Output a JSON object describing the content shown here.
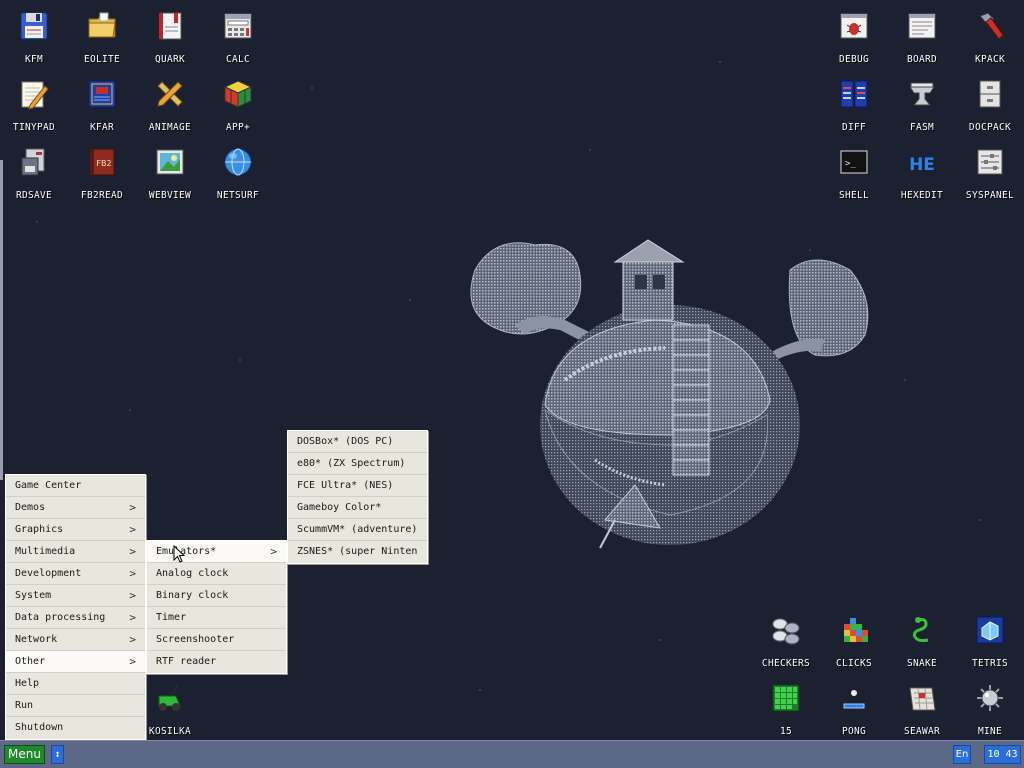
{
  "desktop_icons": {
    "kfm": {
      "label": "KFM",
      "icon": "floppy-icon"
    },
    "eolite": {
      "label": "EOLITE",
      "icon": "folder-icon"
    },
    "quark": {
      "label": "QUARK",
      "icon": "notebook-icon"
    },
    "calc": {
      "label": "CALC",
      "icon": "calculator-icon"
    },
    "tinypad": {
      "label": "TINYPAD",
      "icon": "pencil-paper-icon"
    },
    "kfar": {
      "label": "KFAR",
      "icon": "archive-icon"
    },
    "animage": {
      "label": "ANIMAGE",
      "icon": "ruler-pencil-icon"
    },
    "app_plus": {
      "label": "APP+",
      "icon": "rubik-cube-icon"
    },
    "rdsave": {
      "label": "RDSAVE",
      "icon": "save-disk-icon"
    },
    "fb2read": {
      "label": "FB2READ",
      "icon": "book-icon",
      "badge": "FB2"
    },
    "webview": {
      "label": "WEBVIEW",
      "icon": "web-image-icon"
    },
    "netsurf": {
      "label": "NETSURF",
      "icon": "globe-icon"
    },
    "debug": {
      "label": "DEBUG",
      "icon": "bug-window-icon"
    },
    "board": {
      "label": "BOARD",
      "icon": "board-window-icon"
    },
    "kpack": {
      "label": "KPACK",
      "icon": "hammer-icon"
    },
    "diff": {
      "label": "DIFF",
      "icon": "diff-icon"
    },
    "fasm": {
      "label": "FASM",
      "icon": "anvil-icon"
    },
    "docpack": {
      "label": "DOCPACK",
      "icon": "cabinet-icon"
    },
    "shell": {
      "label": "SHELL",
      "icon": "terminal-icon",
      "prompt": ">_"
    },
    "hexedit": {
      "label": "HEXEDIT",
      "icon": "hex-icon",
      "glyph": "HE"
    },
    "syspanel": {
      "label": "SYSPANEL",
      "icon": "sliders-icon"
    },
    "checkers": {
      "label": "CHECKERS",
      "icon": "checkers-icon"
    },
    "clicks": {
      "label": "CLICKS",
      "icon": "blocks-icon"
    },
    "snake": {
      "label": "SNAKE",
      "icon": "snake-icon"
    },
    "tetris": {
      "label": "TETRIS",
      "icon": "tetris-icon"
    },
    "game15": {
      "label": "15",
      "icon": "grid15-icon"
    },
    "pong": {
      "label": "PONG",
      "icon": "pong-icon"
    },
    "seawar": {
      "label": "SEAWAR",
      "icon": "seawar-icon"
    },
    "mine": {
      "label": "MINE",
      "icon": "mine-icon"
    },
    "kosilka": {
      "label": "KOSILKA",
      "icon": "lawnmower-icon"
    }
  },
  "main_menu": {
    "items": [
      {
        "label": "Game Center",
        "submenu": false
      },
      {
        "label": "Demos",
        "submenu": true,
        "arrow": ">"
      },
      {
        "label": "Graphics",
        "submenu": true,
        "arrow": ">"
      },
      {
        "label": "Multimedia",
        "submenu": true,
        "arrow": ">"
      },
      {
        "label": "Development",
        "submenu": true,
        "arrow": ">"
      },
      {
        "label": "System",
        "submenu": true,
        "arrow": ">"
      },
      {
        "label": "Data processing",
        "submenu": true,
        "arrow": ">"
      },
      {
        "label": "Network",
        "submenu": true,
        "arrow": ">"
      },
      {
        "label": "Other",
        "submenu": true,
        "arrow": ">",
        "active": true
      },
      {
        "label": "Help",
        "submenu": false
      },
      {
        "label": "Run",
        "submenu": false
      },
      {
        "label": "Shutdown",
        "submenu": false
      }
    ]
  },
  "other_submenu": {
    "items": [
      {
        "label": "Emulators*",
        "submenu": true,
        "arrow": ">",
        "active": true
      },
      {
        "label": "Analog clock",
        "submenu": false
      },
      {
        "label": "Binary clock",
        "submenu": false
      },
      {
        "label": "Timer",
        "submenu": false
      },
      {
        "label": "Screenshooter",
        "submenu": false
      },
      {
        "label": "RTF reader",
        "submenu": false
      }
    ]
  },
  "emulators_submenu": {
    "items": [
      {
        "label": "DOSBox* (DOS PC)"
      },
      {
        "label": "e80* (ZX Spectrum)"
      },
      {
        "label": "FCE Ultra* (NES)"
      },
      {
        "label": "Gameboy Color*"
      },
      {
        "label": "ScummVM* (adventure)"
      },
      {
        "label": "ZSNES* (super Ninten"
      }
    ]
  },
  "taskbar": {
    "menu_label": "Menu",
    "switch_label": "↕",
    "language": "En",
    "clock": "10 43"
  },
  "colors": {
    "desktop_bg": "#1b2130",
    "menu_bg": "#e9e6dd",
    "taskbar_bg": "#5c6886",
    "menu_button": "#1f8a2c",
    "indicator": "#2b6fd6"
  }
}
